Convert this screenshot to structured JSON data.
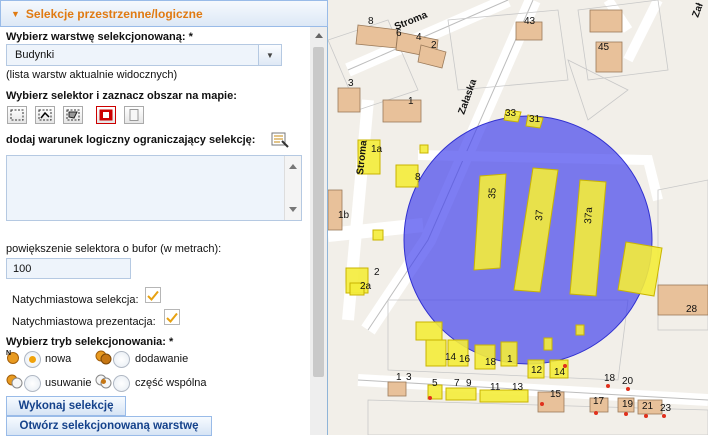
{
  "panel": {
    "title": "Selekcje przestrzenne/logiczne",
    "layer_label": "Wybierz warstwę selekcjonowaną: *",
    "layer_value": "Budynki",
    "layer_hint": "(lista warstw aktualnie widocznych)",
    "selector_label": "Wybierz selektor i zaznacz obszar na mapie:",
    "condition_label": "dodaj warunek logiczny ograniczający selekcję:",
    "condition_value": "",
    "buffer_label": "powiększenie selektora o bufor (w metrach):",
    "buffer_value": "100",
    "instant_selection_label": "Natychmiastowa selekcja:",
    "instant_selection_checked": true,
    "instant_presentation_label": "Natychmiastowa prezentacja:",
    "instant_presentation_checked": true,
    "mode_label": "Wybierz tryb selekcjonowania: *",
    "modes": {
      "new": "nowa",
      "add": "dodawanie",
      "remove": "usuwanie",
      "intersect": "część wspólna"
    },
    "selected_mode": "new",
    "execute_button": "Wykonaj selekcję",
    "open_layer_button": "Otwórz selekcjonowaną warstwę"
  },
  "map": {
    "streets": {
      "stroma_top": "Stroma",
      "zalaska": "Załaska",
      "stroma_left": "Stroma",
      "top_right": "Zał"
    },
    "labels": [
      "8",
      "6",
      "4",
      "2",
      "43",
      "45",
      "3",
      "1",
      "1a",
      "8",
      "1b",
      "2",
      "2a",
      "35",
      "37",
      "37a",
      "33",
      "31",
      "28",
      "14",
      "16",
      "18",
      "1",
      "12",
      "14",
      "1",
      "3",
      "5",
      "7",
      "9",
      "11",
      "13",
      "15",
      "17",
      "18",
      "20",
      "19",
      "21",
      "23"
    ],
    "colors": {
      "selection_circle": "#4040ee",
      "selected_building": "#f4ec3a",
      "building": "#e8c19a",
      "background": "#f2efe9"
    }
  }
}
